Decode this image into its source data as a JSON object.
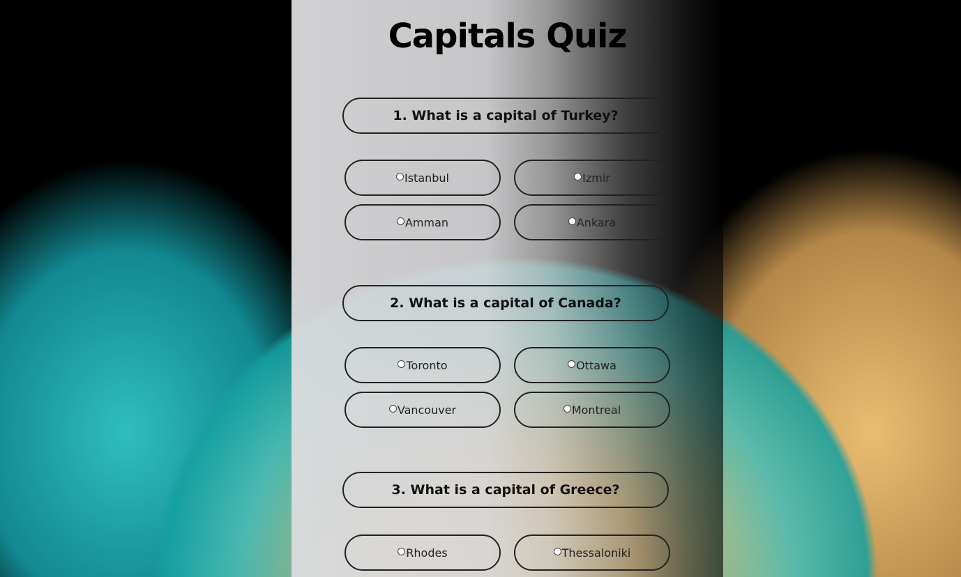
{
  "title": "Capitals Quiz",
  "questions": [
    {
      "text": "1. What is a capital of Turkey?",
      "answers": [
        "Istanbul",
        "Izmir",
        "Amman",
        "Ankara"
      ]
    },
    {
      "text": "2. What is a capital of Canada?",
      "answers": [
        "Toronto",
        "Ottawa",
        "Vancouver",
        "Montreal"
      ]
    },
    {
      "text": "3. What is a capital of Greece?",
      "answers": [
        "Rhodes",
        "Thessaloniki"
      ]
    }
  ]
}
